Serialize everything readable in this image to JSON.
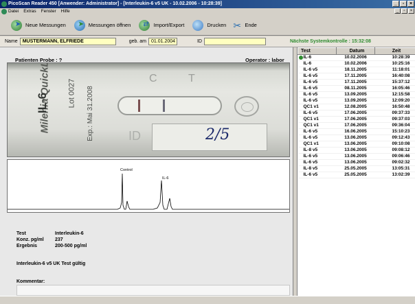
{
  "window": {
    "title": "PicoScan Reader 450  [Anwender: Administrator] - [Interleukin-6 v5 UK - 10.02.2006 - 10:28:39]"
  },
  "menu": {
    "items": [
      "Datei",
      "Extras",
      "Fenster",
      "Hilfe"
    ]
  },
  "toolbar": {
    "new_label": "Neue Messungen",
    "open_label": "Messungen öffnen",
    "importexport_label": "Import/Export",
    "print_label": "Drucken",
    "end_label": "Ende"
  },
  "patient": {
    "name_label": "Name",
    "name_value": "MUSTERMANN, ELFRIEDE",
    "dob_label": "geb. am",
    "dob_value": "01.01.2004",
    "id_label": "ID",
    "id_value": "",
    "next_check": "Nächste Systemkontrolle : 15:32:08"
  },
  "probe": {
    "header": "Patienten Probe : ?",
    "operator": "Operator : labor"
  },
  "strip_photo": {
    "brand": "Milenia QuickLine",
    "analyte": "IL-6",
    "lot": "Lot 0027",
    "exp": "Exp.: Mai 31.2008",
    "c_mark": "C",
    "t_mark": "T",
    "id_mark": "ID",
    "handwriting": "2/5"
  },
  "graph": {
    "control_label": "Control",
    "il6_label": "IL-6"
  },
  "results": {
    "test_label": "Test",
    "test_value": "Interleukin-6",
    "conc_label": "Konz. pg/ml",
    "conc_value": "237",
    "result_label": "Ergebnis",
    "result_value": "200-500 pg/ml",
    "validity": "Interleukin-6 v5 UK  Test gültig",
    "comment_label": "Kommentar:"
  },
  "history": {
    "columns": [
      "Test",
      "Datum",
      "Zeit"
    ],
    "rows": [
      [
        "IL-6",
        "10.02.2006",
        "10:28:39"
      ],
      [
        "IL-6",
        "10.02.2006",
        "10:25:16"
      ],
      [
        "IL-6 v5",
        "18.11.2005",
        "11:18:01"
      ],
      [
        "IL-6 v5",
        "17.11.2005",
        "16:40:08"
      ],
      [
        "IL-6 v5",
        "17.11.2005",
        "15:37:12"
      ],
      [
        "IL-6 v5",
        "08.11.2005",
        "16:05:46"
      ],
      [
        "IL-6 v5",
        "13.09.2005",
        "12:15:58"
      ],
      [
        "IL-6 v5",
        "13.09.2005",
        "12:09:20"
      ],
      [
        "QC1 v1",
        "12.08.2005",
        "16:50:48"
      ],
      [
        "IL-6 v5",
        "17.06.2005",
        "09:37:33"
      ],
      [
        "QC1 v1",
        "17.06.2005",
        "09:37:03"
      ],
      [
        "QC1 v1",
        "17.06.2005",
        "09:36:04"
      ],
      [
        "IL-6 v5",
        "16.06.2005",
        "15:10:23"
      ],
      [
        "IL-6 v5",
        "13.06.2005",
        "09:12:43"
      ],
      [
        "QC1 v1",
        "13.06.2005",
        "09:10:08"
      ],
      [
        "IL-8 v5",
        "13.06.2005",
        "09:08:12"
      ],
      [
        "IL-6 v5",
        "13.06.2005",
        "09:06:46"
      ],
      [
        "IL-6 v5",
        "13.06.2005",
        "09:02:32"
      ],
      [
        "IL-8 v5",
        "25.05.2005",
        "13:05:31"
      ],
      [
        "IL-6 v5",
        "25.05.2005",
        "13:02:39"
      ]
    ]
  }
}
